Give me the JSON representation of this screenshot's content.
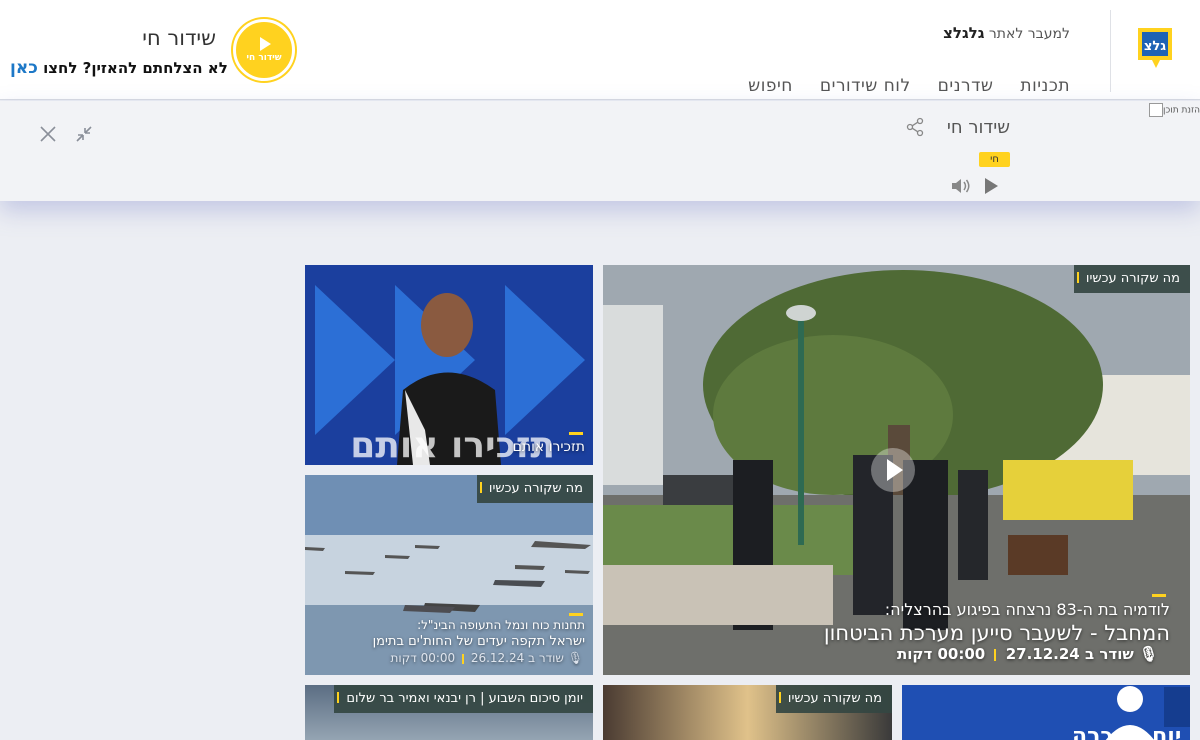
{
  "header": {
    "logo_text": "גלצ",
    "site_link_prefix": "למעבר לאתר",
    "site_link_name": "גלגלצ",
    "nav": [
      "תכניות",
      "שדרנים",
      "לוח שידורים",
      "חיפוש"
    ],
    "live_button_label": "שידור חי",
    "live_title": "שידור חי",
    "live_help_text": "לא הצלחתם להאזין? לחצו",
    "live_help_link": "כאן"
  },
  "player": {
    "broken_image_alt": "הזנת תוכן",
    "title": "שידור חי",
    "live_badge": "חי"
  },
  "cards": {
    "main": {
      "tag": "מה שקורה עכשיו",
      "subtitle": "לודמיה בת ה-83 נרצחה בפיגוע בהרצליה:",
      "title": "המחבל - לשעבר סייען מערכת הביטחון",
      "date": "שודר ב 27.12.24",
      "duration": "00:00 דקות"
    },
    "israel": {
      "caption": "תזכירו אותם",
      "art_text": "תזכירו אותם"
    },
    "jets": {
      "tag": "מה שקורה עכשיו",
      "subtitle": "תחנות כוח ונמל התעופה הבינ\"ל:",
      "title": "ישראל תקפה יעדים של החות'ים בתימן",
      "date": "שודר ב 26.12.24",
      "duration": "00:00 דקות"
    },
    "bottom": [
      {
        "tag": "יומן סיכום השבוע | רן יבנאי ואמיר בר שלום"
      },
      {
        "tag": "מה שקורה עכשיו"
      },
      {
        "art_text": "יום הזוכרה"
      }
    ]
  },
  "colors": {
    "accent_yellow": "#ffd21f",
    "link_blue": "#1d78c7",
    "tag_bg": "#344642"
  }
}
